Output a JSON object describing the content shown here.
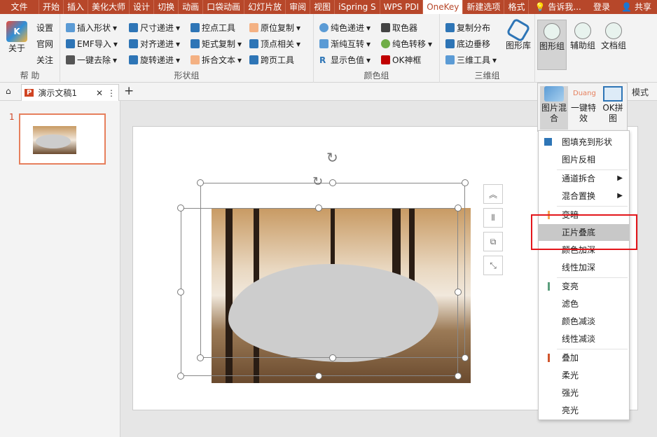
{
  "menubar": {
    "tabs": [
      "文件",
      "开始",
      "插入",
      "美化大师",
      "设计",
      "切换",
      "动画",
      "口袋动画",
      "幻灯片放",
      "审阅",
      "视图",
      "iSpring S",
      "WPS PDI",
      "OneKey",
      "新建选项",
      "格式"
    ],
    "search_placeholder": "告诉我...",
    "login": "登录",
    "share": "共享"
  },
  "ribbon": {
    "help_group": {
      "about": "关于",
      "settings": "设置",
      "website": "官网",
      "attention": "关注",
      "label": "帮 助"
    },
    "shape_group": {
      "col1": [
        "插入形状",
        "EMF导入",
        "一键去除"
      ],
      "col2": [
        "尺寸递进",
        "对齐递进",
        "旋转递进"
      ],
      "col3": [
        "控点工具",
        "矩式复制",
        "拆合文本"
      ],
      "col4": [
        "原位复制",
        "顶点相关",
        "跨页工具"
      ],
      "label": "形状组"
    },
    "color_group": {
      "col1": [
        "纯色递进",
        "渐纯互转",
        "显示色值"
      ],
      "col2": [
        "取色器",
        "纯色转移",
        "OK神框"
      ],
      "label": "颜色组"
    },
    "threed_group": {
      "col1": [
        "复制分布",
        "底边垂移",
        "三维工具"
      ],
      "big": "图形库",
      "label": "三维组"
    },
    "right_buttons": [
      "图形组",
      "辅助组",
      "文档组"
    ]
  },
  "tabs": {
    "doc_title": "演示文稿1",
    "mode_label": "模式"
  },
  "thumbs": {
    "slide_number": "1"
  },
  "popup": {
    "buttons": [
      "图片混合",
      "一键特效",
      "OK拼图"
    ],
    "duang": "Duang"
  },
  "dropdown": {
    "items": [
      {
        "label": "图填充到形状",
        "bar": ""
      },
      {
        "label": "图片反相",
        "bar": ""
      },
      {
        "label": "通道拆合",
        "bar": "",
        "arrow": true
      },
      {
        "label": "混合置换",
        "bar": "",
        "arrow": true
      },
      {
        "label": "变暗",
        "bar": "#f2a654"
      },
      {
        "label": "正片叠底",
        "bar": "",
        "highlight": true
      },
      {
        "label": "颜色加深",
        "bar": ""
      },
      {
        "label": "线性加深",
        "bar": ""
      },
      {
        "label": "变亮",
        "bar": "#5a9e7c"
      },
      {
        "label": "滤色",
        "bar": ""
      },
      {
        "label": "颜色减淡",
        "bar": ""
      },
      {
        "label": "线性减淡",
        "bar": ""
      },
      {
        "label": "叠加",
        "bar": "#d0552d"
      },
      {
        "label": "柔光",
        "bar": ""
      },
      {
        "label": "强光",
        "bar": ""
      },
      {
        "label": "亮光",
        "bar": ""
      }
    ]
  },
  "colors": {
    "accent": "#b7472a",
    "highlight_box": "#e3161b",
    "selection_bg": "#c8c8c8"
  }
}
